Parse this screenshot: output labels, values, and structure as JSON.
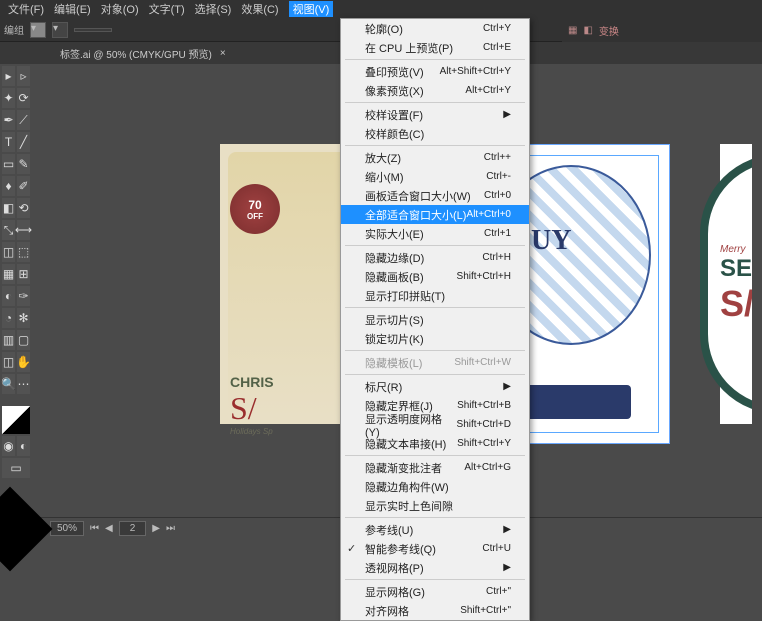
{
  "menubar": [
    "文件(F)",
    "编辑(E)",
    "对象(O)",
    "文字(T)",
    "选择(S)",
    "效果(C)",
    "视图(V)"
  ],
  "toolbar": {
    "label": "编组"
  },
  "doc_tab": "标签.ai @ 50% (CMYK/GPU 预览)",
  "right_panel": {
    "link1": "变换",
    "link2": ""
  },
  "sale": {
    "pct": "70",
    "off": "OFF"
  },
  "tag": {
    "line1": "CHRIS",
    "line2": "S/",
    "line3": "Holidays Sp"
  },
  "artboard2": {
    "text": "UY"
  },
  "artboard3": {
    "merry": "Merry",
    "sea": "SEA",
    "sa": "S/"
  },
  "bottom": {
    "zoom": "50%"
  },
  "menu": {
    "items": [
      {
        "label": "轮廓(O)",
        "short": "Ctrl+Y"
      },
      {
        "label": "在 CPU 上预览(P)",
        "short": "Ctrl+E"
      },
      {
        "sep": true
      },
      {
        "label": "叠印预览(V)",
        "short": "Alt+Shift+Ctrl+Y"
      },
      {
        "label": "像素预览(X)",
        "short": "Alt+Ctrl+Y"
      },
      {
        "sep": true
      },
      {
        "label": "校样设置(F)",
        "short": "",
        "arrow": true
      },
      {
        "label": "校样颜色(C)",
        "short": ""
      },
      {
        "sep": true
      },
      {
        "label": "放大(Z)",
        "short": "Ctrl++"
      },
      {
        "label": "缩小(M)",
        "short": "Ctrl+-"
      },
      {
        "label": "画板适合窗口大小(W)",
        "short": "Ctrl+0"
      },
      {
        "label": "全部适合窗口大小(L)",
        "short": "Alt+Ctrl+0",
        "highlight": true
      },
      {
        "label": "实际大小(E)",
        "short": "Ctrl+1"
      },
      {
        "sep": true
      },
      {
        "label": "隐藏边缘(D)",
        "short": "Ctrl+H"
      },
      {
        "label": "隐藏画板(B)",
        "short": "Shift+Ctrl+H"
      },
      {
        "label": "显示打印拼贴(T)",
        "short": ""
      },
      {
        "sep": true
      },
      {
        "label": "显示切片(S)",
        "short": ""
      },
      {
        "label": "锁定切片(K)",
        "short": ""
      },
      {
        "sep": true
      },
      {
        "label": "隐藏模板(L)",
        "short": "Shift+Ctrl+W",
        "disabled": true
      },
      {
        "sep": true
      },
      {
        "label": "标尺(R)",
        "short": "",
        "arrow": true
      },
      {
        "label": "隐藏定界框(J)",
        "short": "Shift+Ctrl+B"
      },
      {
        "label": "显示透明度网格(Y)",
        "short": "Shift+Ctrl+D"
      },
      {
        "label": "隐藏文本串接(H)",
        "short": "Shift+Ctrl+Y"
      },
      {
        "sep": true
      },
      {
        "label": "隐藏渐变批注者",
        "short": "Alt+Ctrl+G"
      },
      {
        "label": "隐藏边角构件(W)",
        "short": ""
      },
      {
        "label": "显示实时上色间隙",
        "short": ""
      },
      {
        "sep": true
      },
      {
        "label": "参考线(U)",
        "short": "",
        "arrow": true
      },
      {
        "label": "智能参考线(Q)",
        "short": "Ctrl+U",
        "checked": true
      },
      {
        "label": "透视网格(P)",
        "short": "",
        "arrow": true
      },
      {
        "sep": true
      },
      {
        "label": "显示网格(G)",
        "short": "Ctrl+\""
      },
      {
        "label": "对齐网格",
        "short": "Shift+Ctrl+\""
      }
    ]
  }
}
